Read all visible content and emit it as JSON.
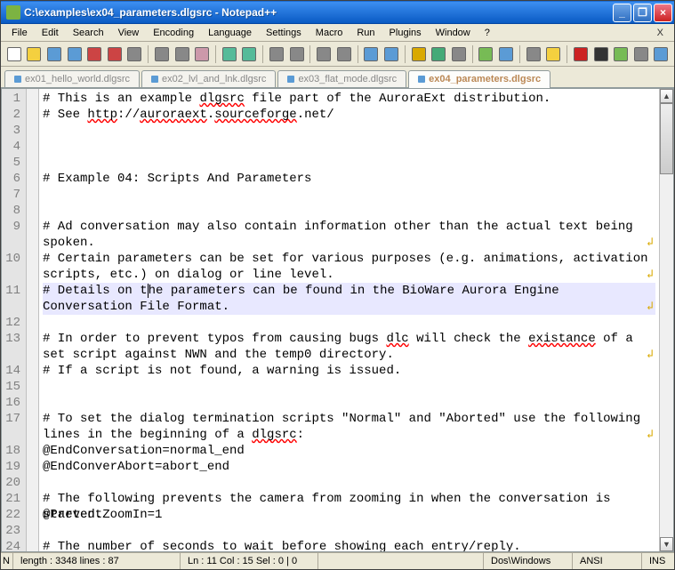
{
  "window": {
    "title": "C:\\examples\\ex04_parameters.dlgsrc - Notepad++"
  },
  "menu": {
    "file": "File",
    "edit": "Edit",
    "search": "Search",
    "view": "View",
    "encoding": "Encoding",
    "language": "Language",
    "settings": "Settings",
    "macro": "Macro",
    "run": "Run",
    "plugins": "Plugins",
    "window": "Window",
    "help": "?",
    "close_x": "X"
  },
  "toolbar_icons": [
    "new-file-icon",
    "open-file-icon",
    "save-icon",
    "save-all-icon",
    "close-icon",
    "close-all-icon",
    "print-icon",
    "sep",
    "cut-icon",
    "copy-icon",
    "paste-icon",
    "sep",
    "undo-icon",
    "redo-icon",
    "sep",
    "find-icon",
    "replace-icon",
    "sep",
    "zoom-in-icon",
    "zoom-out-icon",
    "sep",
    "sync-v-icon",
    "sync-h-icon",
    "sep",
    "wordwrap-icon",
    "allchars-icon",
    "indent-guide-icon",
    "sep",
    "lang-icon",
    "doc-map-icon",
    "sep",
    "func-list-icon",
    "folder-icon",
    "sep",
    "macro-record-icon",
    "macro-stop-icon",
    "macro-play-icon",
    "macro-multi-icon",
    "macro-save-icon"
  ],
  "tabs": [
    {
      "label": "ex01_hello_world.dlgsrc",
      "active": false
    },
    {
      "label": "ex02_lvl_and_lnk.dlgsrc",
      "active": false
    },
    {
      "label": "ex03_flat_mode.dlgsrc",
      "active": false
    },
    {
      "label": "ex04_parameters.dlgsrc",
      "active": true
    }
  ],
  "lines": [
    {
      "n": 1,
      "text": "# This is an example ~dlgsrc~ file part of the AuroraExt distribution."
    },
    {
      "n": 2,
      "text": "# See ~http~://~auroraext~.~sourceforge~.net/"
    },
    {
      "n": 3,
      "text": ""
    },
    {
      "n": 4,
      "text": ""
    },
    {
      "n": 5,
      "text": ""
    },
    {
      "n": 6,
      "text": "# Example 04: Scripts And Parameters"
    },
    {
      "n": 7,
      "text": ""
    },
    {
      "n": 8,
      "text": ""
    },
    {
      "n": 9,
      "text": "# Ad conversation may also contain information other than the actual text being spoken.",
      "wrap": true
    },
    {
      "n": 10,
      "text": "# Certain parameters can be set for various purposes (e.g. animations, activation scripts, etc.) on dialog or line level.",
      "wrap": true
    },
    {
      "n": 11,
      "text": "# Details on t|he parameters can be found in the BioWare Aurora Engine Conversation File Format.",
      "wrap": true,
      "current": true
    },
    {
      "n": 12,
      "text": ""
    },
    {
      "n": 13,
      "text": "# In order to prevent typos from causing bugs ~dlc~ will check the ~existance~ of a set script against NWN and the temp0 directory.",
      "wrap": true
    },
    {
      "n": 14,
      "text": "# If a script is not found, a warning is issued."
    },
    {
      "n": 15,
      "text": ""
    },
    {
      "n": 16,
      "text": ""
    },
    {
      "n": 17,
      "text": "# To set the dialog termination scripts \"Normal\" and \"Aborted\" use the following lines in the beginning of a ~dlgsrc~:",
      "wrap": true
    },
    {
      "n": 18,
      "text": "@EndConversation=normal_end"
    },
    {
      "n": 19,
      "text": "@EndConverAbort=abort_end"
    },
    {
      "n": 20,
      "text": ""
    },
    {
      "n": 21,
      "text": "# The following prevents the camera from zooming in when the conversation is started."
    },
    {
      "n": 22,
      "text": "@PreventZoomIn=1"
    },
    {
      "n": 23,
      "text": ""
    },
    {
      "n": 24,
      "text": "# The number of seconds to wait before showing each entry/reply."
    }
  ],
  "status": {
    "length_lines": "length : 3348    lines : 87",
    "pos": "Ln : 11   Col : 15   Sel : 0 | 0",
    "eol": "Dos\\Windows",
    "enc": "ANSI",
    "ins": "INS"
  },
  "colors": {
    "accent": "#316ac5"
  }
}
